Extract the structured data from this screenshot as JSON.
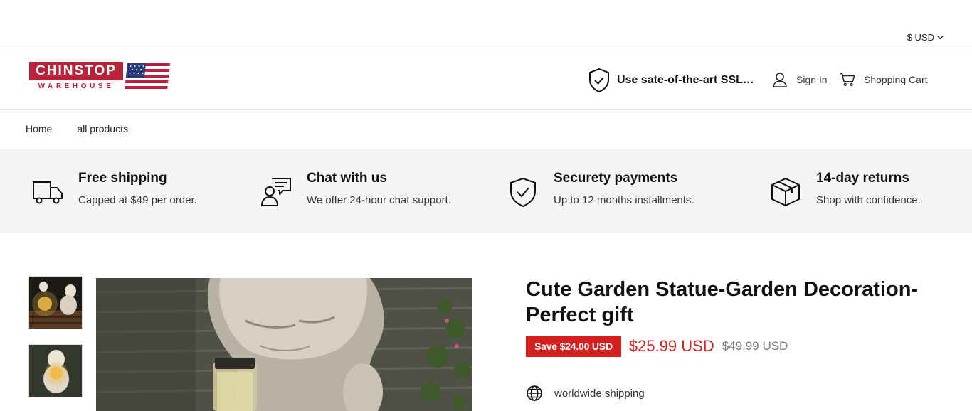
{
  "topbar": {
    "currency": "$ USD"
  },
  "header": {
    "logo_top": "CHINSTOP",
    "logo_bottom": "WAREHOUSE",
    "ssl_text": "Use sate-of-the-art SSL Secure encryption",
    "signin_label": "Sign In",
    "cart_label": "Shopping Cart"
  },
  "nav": {
    "items": [
      "Home",
      "all products"
    ]
  },
  "features": [
    {
      "icon": "truck-icon",
      "title": "Free shipping",
      "desc": "Capped at $49 per order."
    },
    {
      "icon": "chat-icon",
      "title": "Chat with us",
      "desc": "We offer 24-hour chat support."
    },
    {
      "icon": "shield-check-icon",
      "title": "Securety payments",
      "desc": "Up to 12 months installments."
    },
    {
      "icon": "box-icon",
      "title": "14-day returns",
      "desc": "Shop with confidence."
    }
  ],
  "product": {
    "title": "Cute Garden Statue-Garden Decoration-Perfect gift",
    "save_badge": "Save $24.00 USD",
    "price": "$25.99 USD",
    "compare_price": "$49.99 USD",
    "shipping_note": "worldwide shipping"
  },
  "colors": {
    "accent_red": "#d81f1f",
    "logo_red": "#b8223a",
    "feature_bg": "#f5f5f5"
  }
}
